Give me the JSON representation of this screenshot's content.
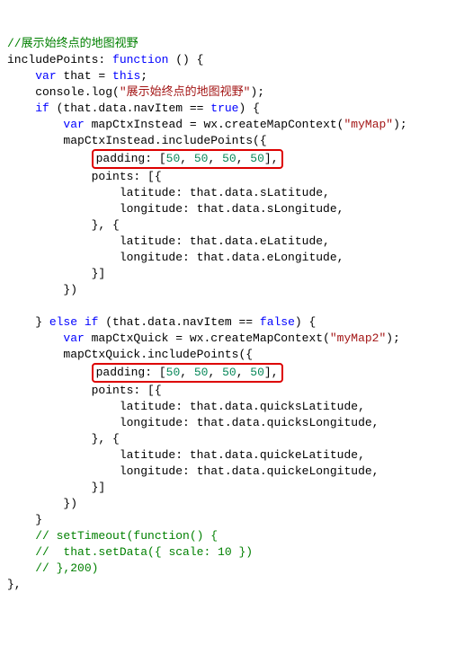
{
  "line01": {
    "comment": "//展示始终点的地图视野"
  },
  "line02": {
    "a": "includePoints",
    "b": ": ",
    "c": "function",
    "d": " () {"
  },
  "line03": {
    "a": "    ",
    "b": "var",
    "c": " that = ",
    "d": "this",
    "e": ";"
  },
  "line04": {
    "a": "    console.log(",
    "b": "\"展示始终点的地图视野\"",
    "c": ");"
  },
  "line05": {
    "a": "    ",
    "b": "if",
    "c": " (that.data.navItem == ",
    "d": "true",
    "e": ") {"
  },
  "line06": {
    "a": "        ",
    "b": "var",
    "c": " mapCtxInstead = wx.createMapContext(",
    "d": "\"myMap\"",
    "e": ");"
  },
  "line07": {
    "a": "        mapCtxInstead.includePoints({"
  },
  "line08": {
    "pad": "            ",
    "hl_a": "padding",
    "hl_b": ": [",
    "hl_n1": "50",
    "hl_c1": ", ",
    "hl_n2": "50",
    "hl_c2": ", ",
    "hl_n3": "50",
    "hl_c3": ", ",
    "hl_n4": "50",
    "hl_c4": "],"
  },
  "line09": {
    "a": "            points: [{"
  },
  "line10": {
    "a": "                latitude: that.data.sLatitude,"
  },
  "line11": {
    "a": "                longitude: that.data.sLongitude,"
  },
  "line12": {
    "a": "            }, {"
  },
  "line13": {
    "a": "                latitude: that.data.eLatitude,"
  },
  "line14": {
    "a": "                longitude: that.data.eLongitude,"
  },
  "line15": {
    "a": "            }]"
  },
  "line16": {
    "a": "        })"
  },
  "line17": {
    "a": ""
  },
  "line18": {
    "a": "    } ",
    "b": "else",
    "c": " ",
    "d": "if",
    "e": " (that.data.navItem == ",
    "f": "false",
    "g": ") {"
  },
  "line19": {
    "a": "        ",
    "b": "var",
    "c": " mapCtxQuick = wx.createMapContext(",
    "d": "\"myMap2\"",
    "e": ");"
  },
  "line20": {
    "a": "        mapCtxQuick.includePoints({"
  },
  "line21": {
    "pad": "            ",
    "hl_a": "padding",
    "hl_b": ": [",
    "hl_n1": "50",
    "hl_c1": ", ",
    "hl_n2": "50",
    "hl_c2": ", ",
    "hl_n3": "50",
    "hl_c3": ", ",
    "hl_n4": "50",
    "hl_c4": "],"
  },
  "line22": {
    "a": "            points: [{"
  },
  "line23": {
    "a": "                latitude: that.data.quicksLatitude,"
  },
  "line24": {
    "a": "                longitude: that.data.quicksLongitude,"
  },
  "line25": {
    "a": "            }, {"
  },
  "line26": {
    "a": "                latitude: that.data.quickeLatitude,"
  },
  "line27": {
    "a": "                longitude: that.data.quickeLongitude,"
  },
  "line28": {
    "a": "            }]"
  },
  "line29": {
    "a": "        })"
  },
  "line30": {
    "a": "    }"
  },
  "line31": {
    "a": "    ",
    "b": "// setTimeout(function() {"
  },
  "line32": {
    "a": "    ",
    "b": "//  that.setData({ scale: 10 })"
  },
  "line33": {
    "a": "    ",
    "b": "// },200)"
  },
  "line34": {
    "a": "},"
  }
}
